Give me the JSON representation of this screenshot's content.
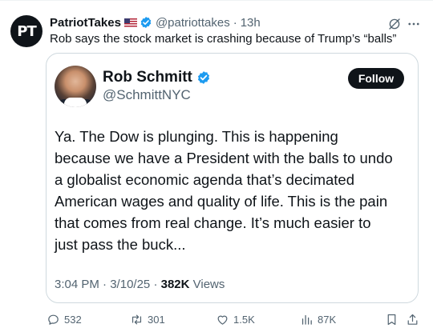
{
  "post": {
    "avatar_text": "PT",
    "author_name": "PatriotTakes",
    "author_flag_icon": "us-flag-icon",
    "handle": "@patriottakes",
    "separator": "·",
    "time": "13h",
    "text": "Rob says the stock market is crashing because of Trump’s “balls”"
  },
  "quote": {
    "name": "Rob Schmitt",
    "handle": "@SchmittNYC",
    "follow_label": "Follow",
    "body_lines": [
      "Ya.  The Dow is plunging.  This is happening",
      "because we have a President with the balls to undo",
      "a globalist economic agenda that’s decimated",
      "American wages and quality of life.  This is the pain",
      "that comes from real change.  It’s much easier to",
      "just pass the buck..."
    ],
    "time": "3:04 PM",
    "date": "3/10/25",
    "views_count": "382K",
    "views_label": "Views"
  },
  "actions": {
    "replies": "532",
    "reposts": "301",
    "likes": "1.5K",
    "views": "87K"
  },
  "colors": {
    "verified": "#1d9bf0",
    "text": "#0f1419",
    "secondary": "#536471",
    "border": "#cfd9de"
  }
}
